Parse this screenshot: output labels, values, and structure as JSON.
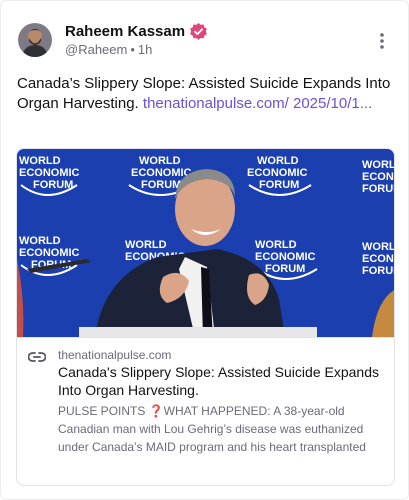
{
  "author": {
    "name": "Raheem Kassam",
    "handle": "@Raheem",
    "separator": "•",
    "time": "1h",
    "verified_color": "#e0467a"
  },
  "post": {
    "text": "Canada’s Slippery Slope: Assisted Suicide Expands Into Organ Harvesting.",
    "link_text": "thenationalpulse.com/ 2025/10/1..."
  },
  "link_card": {
    "domain": "thenationalpulse.com",
    "title": "Canada's Slippery Slope: Assisted Suicide Expands Into Organ Harvesting.",
    "description": "PULSE POINTS ❓WHAT HAPPENED: A 38-year-old Canadian man with Lou Gehrig’s disease was euthanized under Canada’s MAID program and his heart transplanted",
    "image_logo_lines": [
      "WORLD",
      "ECONOMIC",
      "FORUM"
    ]
  },
  "colors": {
    "accent": "#6d50d8",
    "image_background": "#1b3fae"
  },
  "icons": {
    "more": "more-vertical-icon",
    "link": "link-icon",
    "verified": "verified-badge-icon"
  }
}
